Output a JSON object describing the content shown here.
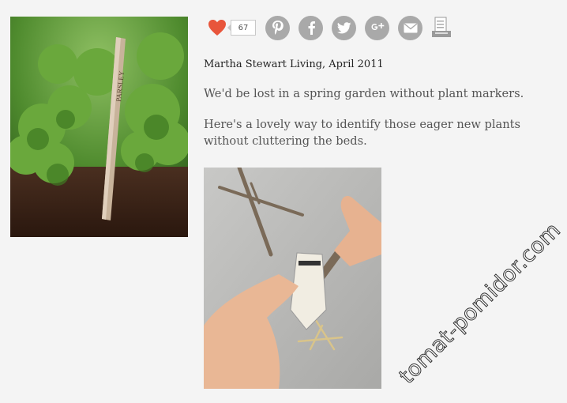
{
  "photos": {
    "left": {
      "marker_text": "PARSLEY"
    }
  },
  "social": {
    "like_count": "67",
    "icons": [
      "heart-icon",
      "pinterest-icon",
      "facebook-icon",
      "twitter-icon",
      "google-plus-icon",
      "email-icon",
      "print-icon"
    ],
    "colors": {
      "heart": "#e8553b",
      "circle": "#a9a9a9"
    }
  },
  "article": {
    "source": "Martha Stewart Living, April 2011",
    "paragraphs": [
      "We'd be lost in a spring garden without plant markers.",
      "Here's a lovely way to identify those eager new plants without cluttering the beds."
    ]
  },
  "watermark": "tomat-pomidor.com"
}
